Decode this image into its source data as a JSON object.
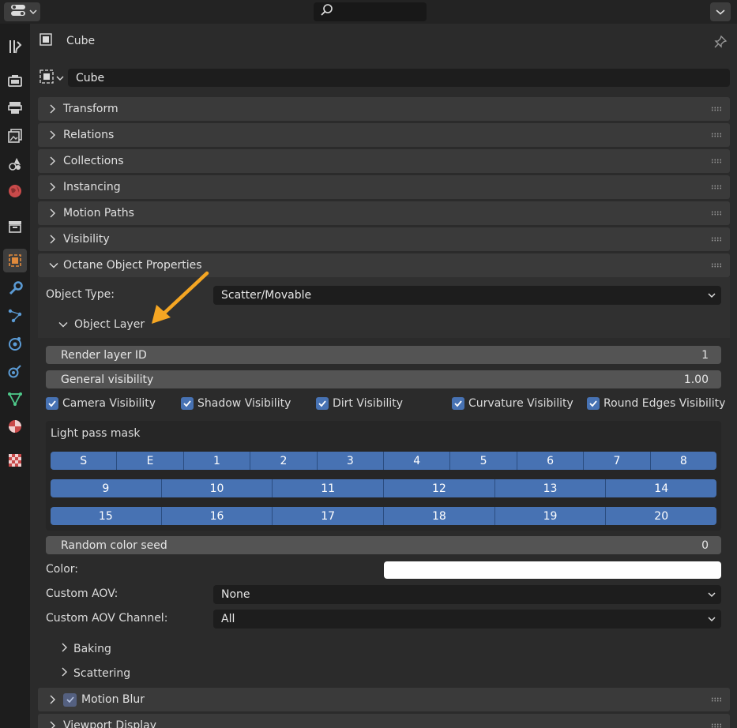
{
  "header": {
    "object_name": "Cube"
  },
  "name_field": {
    "value": "Cube"
  },
  "panels": [
    {
      "label": "Transform"
    },
    {
      "label": "Relations"
    },
    {
      "label": "Collections"
    },
    {
      "label": "Instancing"
    },
    {
      "label": "Motion Paths"
    },
    {
      "label": "Visibility"
    },
    {
      "label": "Octane Object Properties"
    }
  ],
  "octane": {
    "object_type_label": "Object Type:",
    "object_type_value": "Scatter/Movable",
    "object_layer_label": "Object Layer",
    "render_layer_id_label": "Render layer ID",
    "render_layer_id_value": "1",
    "general_visibility_label": "General visibility",
    "general_visibility_value": "1.00",
    "checks": [
      {
        "label": "Camera Visibility",
        "checked": true
      },
      {
        "label": "Shadow Visibility",
        "checked": true
      },
      {
        "label": "Dirt Visibility",
        "checked": true
      },
      {
        "label": "Curvature Visibility",
        "checked": true
      },
      {
        "label": "Round Edges Visibility",
        "checked": true
      }
    ],
    "light_pass_mask_label": "Light pass mask",
    "mask_rows": [
      [
        "S",
        "E",
        "1",
        "2",
        "3",
        "4",
        "5",
        "6",
        "7",
        "8"
      ],
      [
        "9",
        "10",
        "11",
        "12",
        "13",
        "14"
      ],
      [
        "15",
        "16",
        "17",
        "18",
        "19",
        "20"
      ]
    ],
    "random_color_seed_label": "Random color seed",
    "random_color_seed_value": "0",
    "color_label": "Color:",
    "color_value": "#ffffff",
    "custom_aov_label": "Custom AOV:",
    "custom_aov_value": "None",
    "custom_aov_channel_label": "Custom AOV Channel:",
    "custom_aov_channel_value": "All",
    "baking_label": "Baking",
    "scattering_label": "Scattering"
  },
  "motion_blur": {
    "label": "Motion Blur",
    "checked": true
  },
  "viewport_display": {
    "label": "Viewport Display"
  },
  "colors": {
    "accent": "#4772b3",
    "annotation_arrow": "#f5a623"
  }
}
